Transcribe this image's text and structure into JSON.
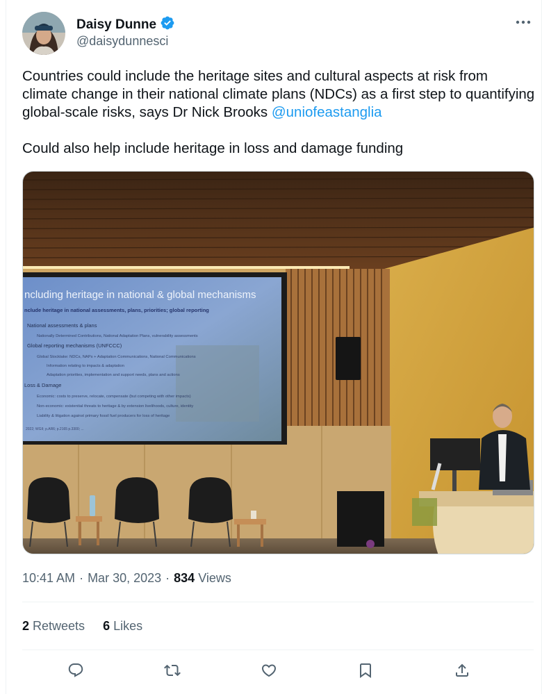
{
  "author": {
    "display_name": "Daisy Dunne",
    "handle": "@daisydunnesci",
    "verified_icon": "verified-badge-icon",
    "verified_color": "#1d9bf0"
  },
  "more_icon": "more-icon",
  "tweet": {
    "paragraph1_prefix": "Countries could include the heritage sites and cultural aspects at risk from climate change in their national climate plans (NDCs) as a first step to quantifying global-scale risks, says Dr Nick Brooks ",
    "mention": "@uniofeastanglia",
    "paragraph2": "Could also help include heritage in loss and damage funding"
  },
  "slide": {
    "title": "ncluding heritage in national & global mechanisms",
    "subtitle": "nclude heritage in national assessments, plans, priorities; global reporting",
    "lines": [
      "National assessments & plans",
      "Nationally Determined Contributions, National Adaptation Plans, vulnerability assessments",
      "Global reporting mechanisms (UNFCCC)",
      "Global Stocktake: NDCs, NAPs + Adaptation Communications, National Communications",
      "Information relating to impacts & adaptation",
      "Adaptation priorities, implementation and support needs, plans and actions",
      "Loss & Damage",
      "Economic: costs to preserve, relocate, compensate (but competing with other impacts)",
      "Non-economic: existential threats to heritage & by extension livelihoods, culture, identity",
      "Liability & litigation against primary fossil fuel producers for loss of heritage"
    ],
    "footer": "2022; WGII; p.AR6; p.2165 p.3300; ..."
  },
  "meta": {
    "time": "10:41 AM",
    "separator": "·",
    "date": "Mar 30, 2023",
    "views_count": "834",
    "views_label": "Views"
  },
  "stats": {
    "retweets_count": "2",
    "retweets_label": "Retweets",
    "likes_count": "6",
    "likes_label": "Likes"
  },
  "actions": [
    {
      "name": "reply-button",
      "icon": "reply-icon"
    },
    {
      "name": "retweet-button",
      "icon": "retweet-icon"
    },
    {
      "name": "like-button",
      "icon": "heart-icon"
    },
    {
      "name": "bookmark-button",
      "icon": "bookmark-icon"
    },
    {
      "name": "share-button",
      "icon": "share-icon"
    }
  ],
  "colors": {
    "link": "#1d9bf0",
    "secondary_text": "#536471",
    "primary_text": "#0f1419"
  }
}
